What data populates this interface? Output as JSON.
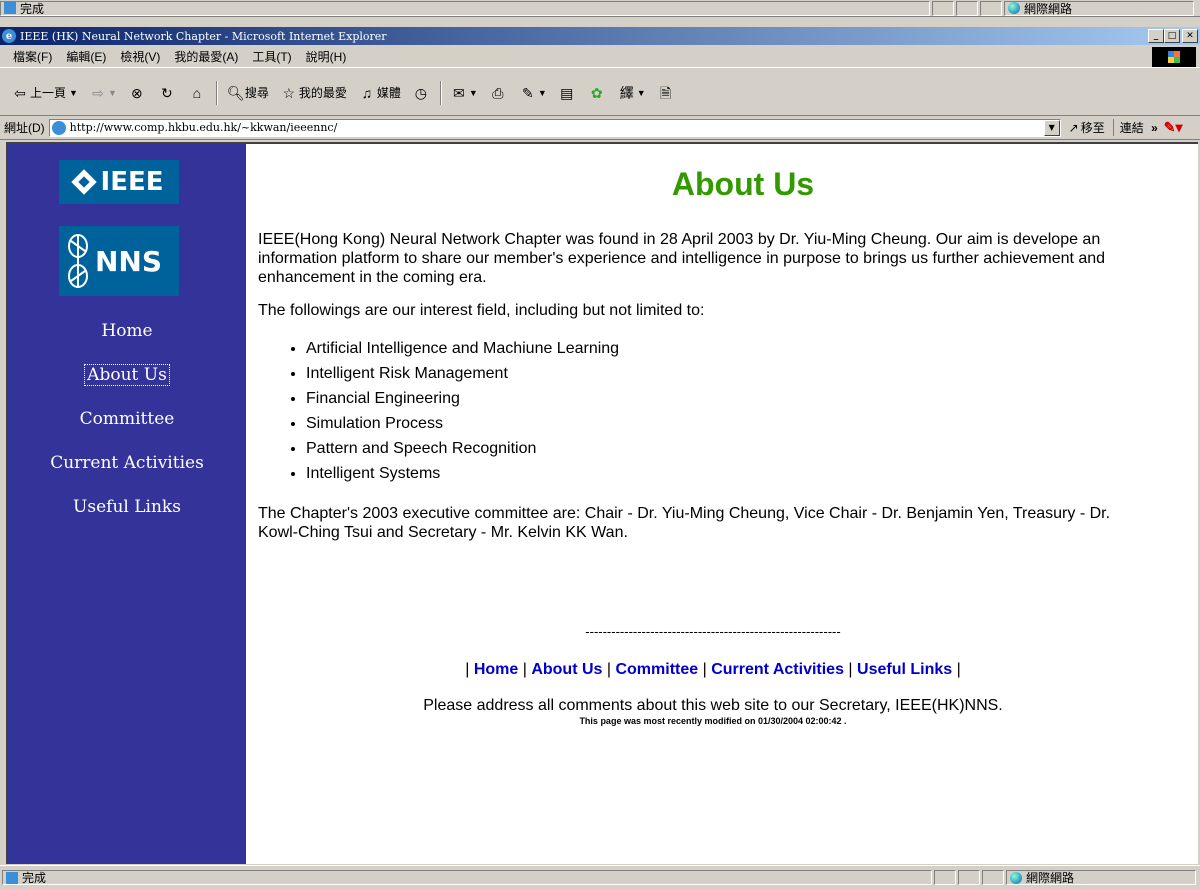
{
  "top_status": {
    "text": "完成",
    "zone": "網際網路"
  },
  "window": {
    "title": "IEEE (HK) Neural Network Chapter - Microsoft Internet Explorer"
  },
  "menu": [
    "檔案(F)",
    "編輯(E)",
    "檢視(V)",
    "我的最愛(A)",
    "工具(T)",
    "說明(H)"
  ],
  "toolbar": {
    "back": "上一頁",
    "search": "搜尋",
    "favorites": "我的最愛",
    "media": "媒體"
  },
  "address": {
    "label": "網址(D)",
    "url": "http://www.comp.hkbu.edu.hk/~kkwan/ieeennc/",
    "go": "移至",
    "links": "連結"
  },
  "logos": {
    "ieee": "IEEE",
    "nns": "NNS"
  },
  "sidebar": {
    "items": [
      {
        "label": "Home"
      },
      {
        "label": "About Us"
      },
      {
        "label": "Committee"
      },
      {
        "label": "Current Activities"
      },
      {
        "label": "Useful Links"
      }
    ]
  },
  "main": {
    "title": "About Us",
    "intro": "IEEE(Hong Kong) Neural Network Chapter was found in 28 April 2003 by Dr. Yiu-Ming Cheung. Our aim is develope an information platform to share our member's experience and intelligence in purpose to brings us further achievement and enhancement in the coming era.",
    "interest_intro": "The followings are our interest field, including but not limited to:",
    "interests": [
      "Artificial Intelligence and Machiune Learning",
      "Intelligent Risk Management",
      "Financial Engineering",
      "Simulation Process",
      "Pattern and Speech Recognition",
      "Intelligent Systems"
    ],
    "committee": "The Chapter's 2003 executive committee are: Chair - Dr. Yiu-Ming Cheung, Vice Chair - Dr. Benjamin Yen, Treasury - Dr. Kowl-Ching Tsui and Secretary - Mr. Kelvin KK Wan."
  },
  "footer": {
    "dashes": "-----------------------------------------------------------",
    "links": [
      "Home",
      "About Us",
      "Committee",
      "Current Activities",
      "Useful Links"
    ],
    "address_note": "Please address all comments about this web site to our Secretary, IEEE(HK)NNS.",
    "modified": "This page was most recently modified on 01/30/2004 02:00:42 ."
  },
  "bottom_status": {
    "text": "完成",
    "zone": "網際網路"
  }
}
